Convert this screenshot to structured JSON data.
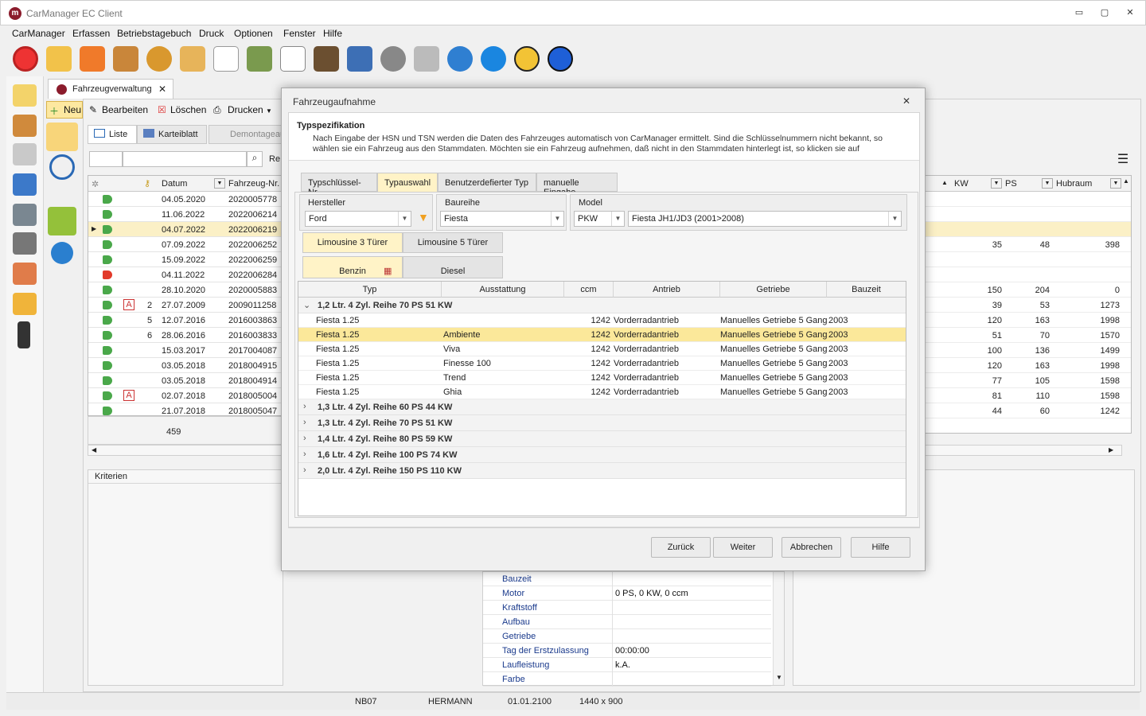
{
  "window": {
    "title": "CarManager EC Client",
    "minimize": "▭",
    "restore": "▢",
    "close": "✕"
  },
  "menu": [
    "CarManager",
    "Erfassen",
    "Betriebstagebuch",
    "Druck",
    "Optionen",
    "Fenster",
    "Hilfe"
  ],
  "doc_tab": {
    "label": "Fahrzeugverwaltung",
    "close": "✕"
  },
  "commands": {
    "new": "Neu",
    "edit": "Bearbeiten",
    "delete": "Löschen",
    "print": "Drucken"
  },
  "view_tabs": [
    "Liste",
    "Karteiblatt",
    "Demontageau"
  ],
  "search": {
    "placeholder": "",
    "label": "Re"
  },
  "grid": {
    "headers": {
      "datum": "Datum",
      "fahrzeug": "Fahrzeug-Nr."
    },
    "rows": [
      {
        "n": "",
        "d": "04.05.2020",
        "f": "2020005778",
        "tag": "green",
        "mark": ""
      },
      {
        "n": "",
        "d": "11.06.2022",
        "f": "2022006214",
        "tag": "green",
        "mark": ""
      },
      {
        "n": "",
        "d": "04.07.2022",
        "f": "2022006219",
        "tag": "green",
        "mark": "",
        "sel": true
      },
      {
        "n": "",
        "d": "07.09.2022",
        "f": "2022006252",
        "tag": "green",
        "mark": ""
      },
      {
        "n": "",
        "d": "15.09.2022",
        "f": "2022006259",
        "tag": "green",
        "mark": ""
      },
      {
        "n": "",
        "d": "04.11.2022",
        "f": "2022006284",
        "tag": "red",
        "mark": ""
      },
      {
        "n": "",
        "d": "28.10.2020",
        "f": "2020005883",
        "tag": "green",
        "mark": ""
      },
      {
        "n": "2",
        "d": "27.07.2009",
        "f": "2009011258",
        "tag": "green",
        "mark": "A"
      },
      {
        "n": "5",
        "d": "12.07.2016",
        "f": "2016003863",
        "tag": "green",
        "mark": ""
      },
      {
        "n": "6",
        "d": "28.06.2016",
        "f": "2016003833",
        "tag": "green",
        "mark": ""
      },
      {
        "n": "",
        "d": "15.03.2017",
        "f": "2017004087",
        "tag": "green",
        "mark": ""
      },
      {
        "n": "",
        "d": "03.05.2018",
        "f": "2018004915",
        "tag": "green",
        "mark": ""
      },
      {
        "n": "",
        "d": "03.05.2018",
        "f": "2018004914",
        "tag": "green",
        "mark": ""
      },
      {
        "n": "",
        "d": "02.07.2018",
        "f": "2018005004",
        "tag": "green",
        "mark": "A"
      },
      {
        "n": "",
        "d": "21.07.2018",
        "f": "2018005047",
        "tag": "green",
        "mark": ""
      }
    ],
    "count": "459"
  },
  "right_grid": {
    "headers": {
      "kw": "KW",
      "ps": "PS",
      "hubraum": "Hubraum"
    },
    "rows": [
      {
        "kw": "",
        "ps": "",
        "h": ""
      },
      {
        "kw": "",
        "ps": "",
        "h": ""
      },
      {
        "kw": "",
        "ps": "",
        "h": "",
        "sel": true
      },
      {
        "kw": "35",
        "ps": "48",
        "h": "398"
      },
      {
        "kw": "",
        "ps": "",
        "h": ""
      },
      {
        "kw": "",
        "ps": "",
        "h": ""
      },
      {
        "kw": "150",
        "ps": "204",
        "h": "0"
      },
      {
        "kw": "39",
        "ps": "53",
        "h": "1273"
      },
      {
        "kw": "120",
        "ps": "163",
        "h": "1998"
      },
      {
        "kw": "51",
        "ps": "70",
        "h": "1570"
      },
      {
        "kw": "100",
        "ps": "136",
        "h": "1499"
      },
      {
        "kw": "120",
        "ps": "163",
        "h": "1998"
      },
      {
        "kw": "77",
        "ps": "105",
        "h": "1598"
      },
      {
        "kw": "81",
        "ps": "110",
        "h": "1598"
      },
      {
        "kw": "44",
        "ps": "60",
        "h": "1242"
      }
    ]
  },
  "criteria": {
    "label": "Kriterien"
  },
  "properties": [
    {
      "label": "Bauzeit",
      "value": ""
    },
    {
      "label": "Motor",
      "value": "0 PS, 0 KW, 0 ccm"
    },
    {
      "label": "Kraftstoff",
      "value": ""
    },
    {
      "label": "Aufbau",
      "value": ""
    },
    {
      "label": "Getriebe",
      "value": ""
    },
    {
      "label": "Tag der Erstzulassung",
      "value": "00:00:00"
    },
    {
      "label": "Laufleistung",
      "value": "k.A."
    },
    {
      "label": "Farbe",
      "value": ""
    }
  ],
  "dialog": {
    "title": "Fahrzeugaufnahme",
    "close": "✕",
    "heading": "Typspezifikation",
    "desc1": "Nach Eingabe der HSN und TSN werden die Daten des Fahrzeuges automatisch von CarManager ermittelt. Sind die Schlüsselnummern nicht bekannt, so",
    "desc2": "wählen sie ein Fahrzeug aus den Stammdaten. Möchten sie ein Fahrzeug aufnehmen, daß nicht in den Stammdaten hinterlegt ist, so klicken sie auf",
    "tabs": [
      "Typschlüssel-Nr.",
      "Typauswahl",
      "Benutzerdefierter Typ",
      "manuelle Eingabe"
    ],
    "hersteller": {
      "label": "Hersteller",
      "value": "Ford"
    },
    "baureihe": {
      "label": "Baureihe",
      "value": "Fiesta"
    },
    "model": {
      "label": "Model",
      "kind": "PKW",
      "value": "Fiesta JH1/JD3 (2001>2008)"
    },
    "body_tabs": [
      "Limousine 3 Türer",
      "Limousine 5 Türer"
    ],
    "fuel_tabs": [
      "Benzin",
      "Diesel"
    ],
    "columns": [
      "Typ",
      "Ausstattung",
      "ccm",
      "Antrieb",
      "Getriebe",
      "Bauzeit"
    ],
    "group_open": "1,2 Ltr. 4 Zyl. Reihe 70 PS 51 KW",
    "rows": [
      {
        "typ": "Fiesta 1.25",
        "aus": "",
        "ccm": "1242",
        "antrieb": "Vorderradantrieb",
        "getriebe": "Manuelles Getriebe 5 Gang",
        "bauzeit": "2003"
      },
      {
        "typ": "Fiesta 1.25",
        "aus": "Ambiente",
        "ccm": "1242",
        "antrieb": "Vorderradantrieb",
        "getriebe": "Manuelles Getriebe 5 Gang",
        "bauzeit": "2003",
        "sel": true
      },
      {
        "typ": "Fiesta 1.25",
        "aus": "Viva",
        "ccm": "1242",
        "antrieb": "Vorderradantrieb",
        "getriebe": "Manuelles Getriebe 5 Gang",
        "bauzeit": "2003"
      },
      {
        "typ": "Fiesta 1.25",
        "aus": "Finesse 100",
        "ccm": "1242",
        "antrieb": "Vorderradantrieb",
        "getriebe": "Manuelles Getriebe 5 Gang",
        "bauzeit": "2003"
      },
      {
        "typ": "Fiesta 1.25",
        "aus": "Trend",
        "ccm": "1242",
        "antrieb": "Vorderradantrieb",
        "getriebe": "Manuelles Getriebe 5 Gang",
        "bauzeit": "2003"
      },
      {
        "typ": "Fiesta 1.25",
        "aus": "Ghia",
        "ccm": "1242",
        "antrieb": "Vorderradantrieb",
        "getriebe": "Manuelles Getriebe 5 Gang",
        "bauzeit": "2003"
      }
    ],
    "groups_closed": [
      "1,3 Ltr. 4 Zyl. Reihe 60 PS 44 KW",
      "1,3 Ltr. 4 Zyl. Reihe 70 PS 51 KW",
      "1,4 Ltr. 4 Zyl. Reihe 80 PS 59 KW",
      "1,6 Ltr. 4 Zyl. Reihe 100 PS 74 KW",
      "2,0 Ltr. 4 Zyl. Reihe 150 PS 110 KW"
    ],
    "buttons": {
      "back": "Zurück",
      "next": "Weiter",
      "cancel": "Abbrechen",
      "help": "Hilfe"
    }
  },
  "status": {
    "station": "NB07",
    "user": "HERMANN",
    "date": "01.01.2100",
    "resolution": "1440 x 900"
  },
  "colors": {
    "accent_yellow": "#fbe89a",
    "selection": "#fbf0c6"
  }
}
